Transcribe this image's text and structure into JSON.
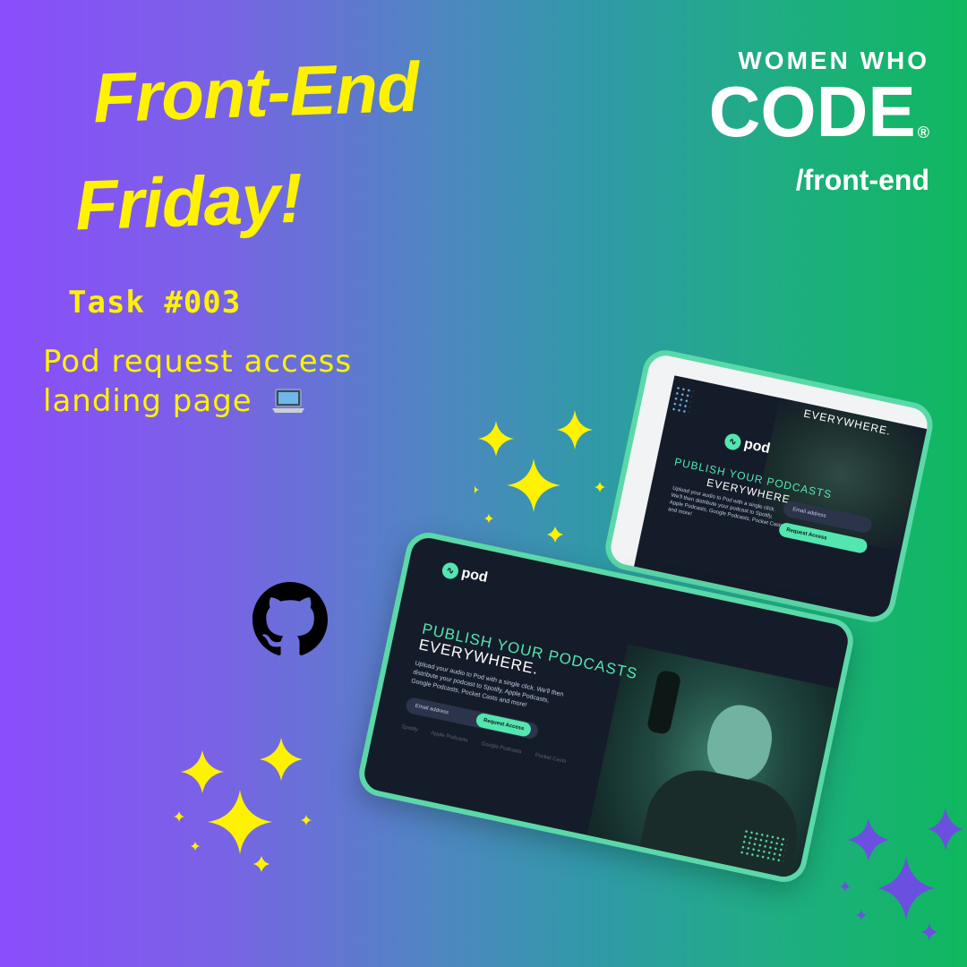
{
  "title_line_1": "Front-End",
  "title_line_2": "Friday!",
  "task_label": "Task #003",
  "description_line_1": "Pod request access",
  "description_line_2": "landing page",
  "description_icon": "laptop-icon",
  "brand": {
    "top": "WOMEN WHO",
    "code": "CODE",
    "registered": "®",
    "sub": "/front-end"
  },
  "colors": {
    "title": "#fff200",
    "accent": "#54e6af",
    "mockup_border": "#5bd8a8",
    "mockup_bg": "#151c29"
  },
  "mockup": {
    "logo_text": "pod",
    "headline_1": "PUBLISH YOUR PODCASTS",
    "headline_2": "EVERYWHERE.",
    "body": "Upload your audio to Pod with a single click. We'll then distribute your podcast to Spotify, Apple Podcasts, Google Podcasts, Pocket Casts and more!",
    "email_placeholder": "Email address",
    "button_label": "Request Access",
    "platforms": [
      "Spotify",
      "Apple Podcasts",
      "Google Podcasts",
      "Pocket Casts"
    ]
  },
  "icons": [
    "github-icon",
    "sparkle-icon"
  ]
}
